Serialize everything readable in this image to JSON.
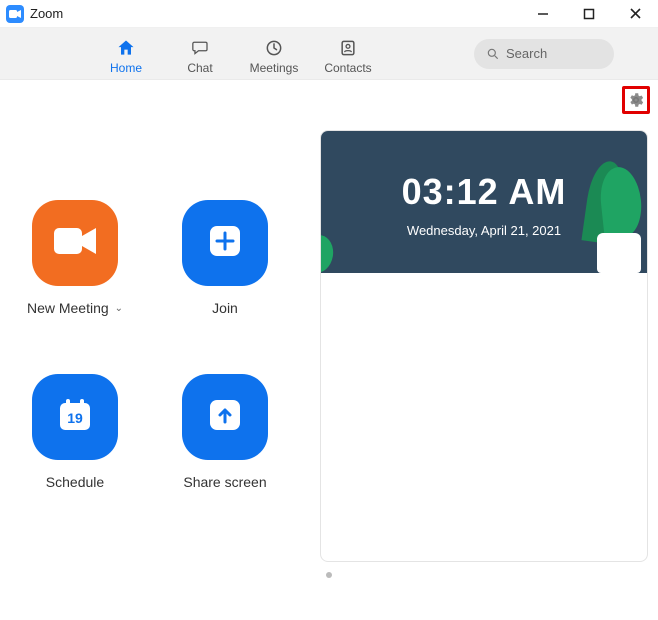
{
  "window": {
    "title": "Zoom"
  },
  "nav": {
    "tabs": [
      {
        "id": "home",
        "label": "Home",
        "active": true
      },
      {
        "id": "chat",
        "label": "Chat",
        "active": false
      },
      {
        "id": "meetings",
        "label": "Meetings",
        "active": false
      },
      {
        "id": "contacts",
        "label": "Contacts",
        "active": false
      }
    ],
    "search_placeholder": "Search"
  },
  "actions": {
    "new_meeting": "New Meeting",
    "join": "Join",
    "schedule": "Schedule",
    "share_screen": "Share screen",
    "schedule_day": "19"
  },
  "clock": {
    "time": "03:12 AM",
    "date": "Wednesday, April 21, 2021"
  },
  "colors": {
    "accent_blue": "#0E72ED",
    "accent_orange": "#F26D21",
    "highlight_red": "#E10000"
  }
}
